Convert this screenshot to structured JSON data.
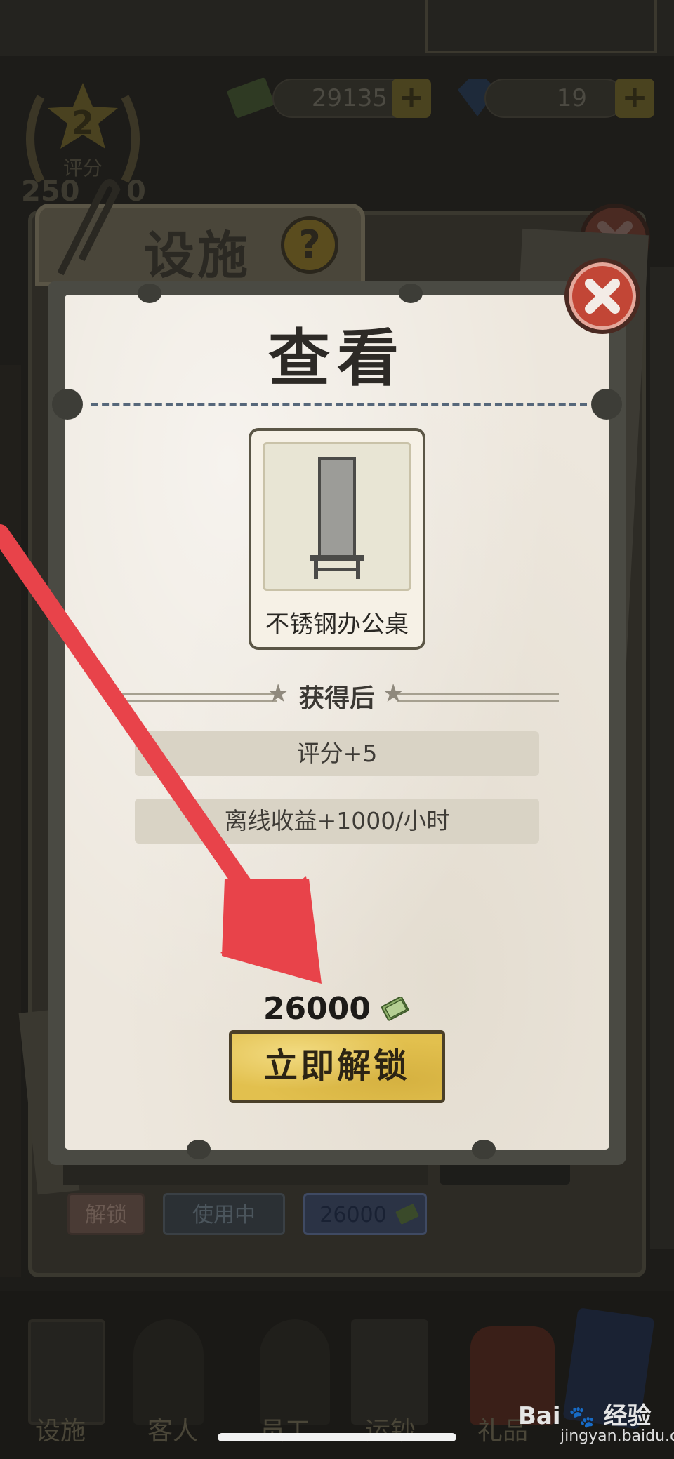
{
  "hud": {
    "money_value": "29135",
    "gems_value": "19",
    "score_level": "2",
    "score_label": "评分",
    "score_value": "250",
    "score_value_suffix": "0"
  },
  "facility_panel": {
    "title": "设施",
    "help_label": "?",
    "tabs": [
      {
        "label": "解锁"
      },
      {
        "label": "使用中"
      },
      {
        "label": "26000"
      }
    ]
  },
  "bottom_nav": {
    "items": [
      {
        "label": "设施"
      },
      {
        "label": "客人"
      },
      {
        "label": "员工"
      },
      {
        "label": "运钞"
      },
      {
        "label": "礼品"
      }
    ]
  },
  "dialog": {
    "title": "查看",
    "item_name": "不锈钢办公桌",
    "section_heading": "获得后",
    "stats": [
      {
        "text": "评分+5"
      },
      {
        "text": "离线收益+1000/小时"
      }
    ],
    "price": "26000",
    "unlock_label": "立即解锁"
  },
  "watermark": {
    "brand": "Bai",
    "brand_cn": "经验",
    "url": "jingyan.baidu.com"
  },
  "colors": {
    "accent_gold": "#e2c04e",
    "close_red": "#c24636",
    "arrow_red": "#e8434a",
    "paper": "#ede7dd"
  },
  "icons": [
    "cash-icon",
    "gem-icon",
    "close-icon",
    "help-icon",
    "star-icon",
    "arrow-annotation"
  ]
}
